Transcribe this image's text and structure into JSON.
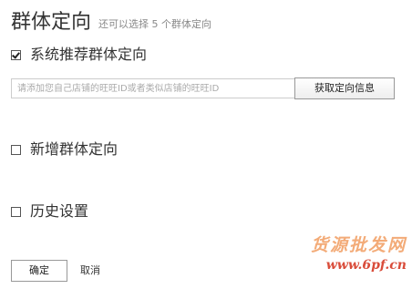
{
  "header": {
    "title": "群体定向",
    "subtitle": "还可以选择 5 个群体定向"
  },
  "options": [
    {
      "label": "系统推荐群体定向",
      "checked": true
    },
    {
      "label": "新增群体定向",
      "checked": false
    },
    {
      "label": "历史设置",
      "checked": false
    }
  ],
  "store_input": {
    "value": "",
    "placeholder": "请添加您自己店铺的旺旺ID或者类似店铺的旺旺ID"
  },
  "fetch_button_label": "获取定向信息",
  "footer": {
    "confirm_label": "确定",
    "cancel_label": "取消"
  },
  "watermark": {
    "text": "货源批发网",
    "url": "www.6pf.cn"
  },
  "colors": {
    "watermark_text": "#f2a36a",
    "watermark_url": "#d94c3a"
  }
}
